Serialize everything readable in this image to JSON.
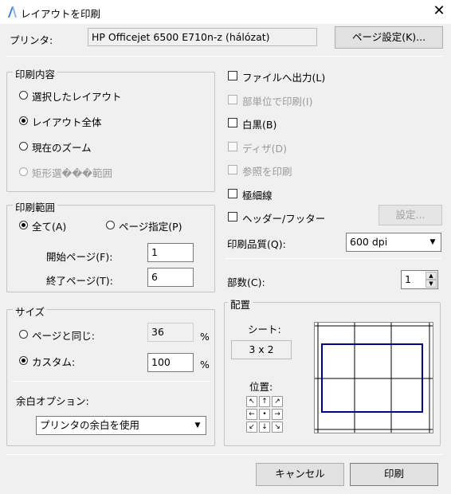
{
  "window": {
    "title": "レイアウトを印刷",
    "close_glyph": "✕"
  },
  "printer": {
    "label": "プリンタ:",
    "name": "HP Officejet 6500 E710n-z (hálózat)",
    "page_setup_button": "ページ設定(K)..."
  },
  "content_group": {
    "title": "印刷内容",
    "options": [
      {
        "label": "選択したレイアウト",
        "checked": false,
        "disabled": false
      },
      {
        "label": "レイアウト全体",
        "checked": true,
        "disabled": false
      },
      {
        "label": "現在のズーム",
        "checked": false,
        "disabled": false
      },
      {
        "label": "矩形選���範囲",
        "checked": false,
        "disabled": true
      }
    ]
  },
  "range_group": {
    "title": "印刷範囲",
    "all_label": "全て(A)",
    "pages_label": "ページ指定(P)",
    "start_label": "開始ページ(F):",
    "start_value": "1",
    "end_label": "終了ページ(T):",
    "end_value": "6"
  },
  "size_group": {
    "title": "サイズ",
    "same_label": "ページと同じ:",
    "same_value": "36",
    "custom_label": "カスタム:",
    "custom_value": "100",
    "percent": "%",
    "margin_label": "余白オプション:",
    "margin_value": "プリンタの余白を使用"
  },
  "options": {
    "file_output": "ファイルへ出力(L)",
    "by_unit": "部単位で印刷(I)",
    "mono": "白黒(B)",
    "dither": "ディザ(D)",
    "print_refs": "参照を印刷",
    "hairline": "極細線",
    "header_footer": "ヘッダー/フッター",
    "settings_button": "設定...",
    "quality_label": "印刷品質(Q):",
    "quality_value": "600 dpi",
    "copies_label": "部数(C):",
    "copies_value": "1"
  },
  "placement_group": {
    "title": "配置",
    "sheet_label": "シート:",
    "sheet_value": "3 x 2",
    "position_label": "位置:",
    "arrows": [
      "↖",
      "↑",
      "↗",
      "←",
      "•",
      "→",
      "↙",
      "↓",
      "↘"
    ],
    "accent_color": "#00008b"
  },
  "footer": {
    "cancel_button": "キャンセル",
    "print_button": "印刷"
  }
}
